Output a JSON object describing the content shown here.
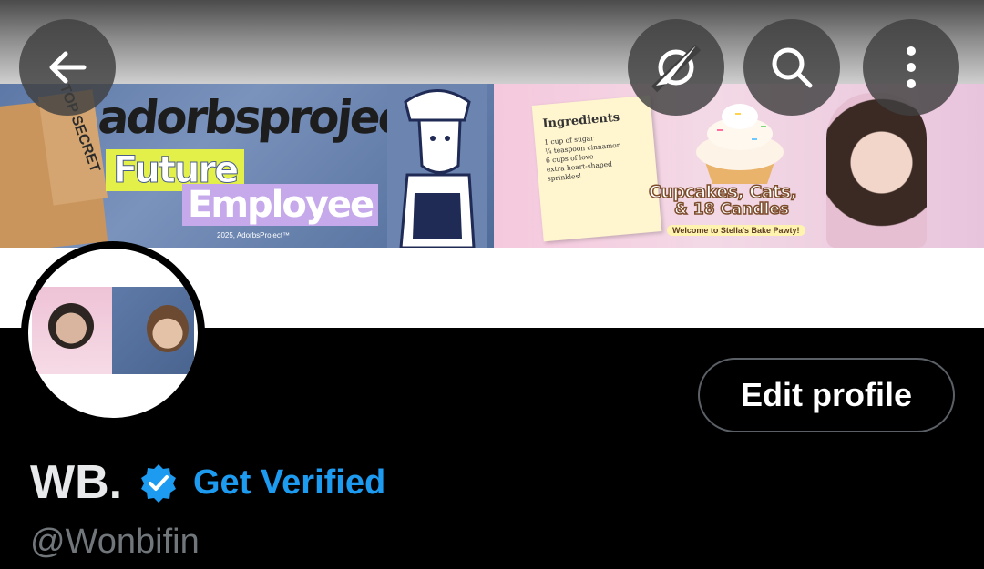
{
  "banner": {
    "left": {
      "box_text": "TOP SECRET",
      "brand": "adorbsproject™",
      "line1": "Future",
      "line2": "Employee",
      "copyright": "2025, AdorbsProject™"
    },
    "right": {
      "ingredients_title": "Ingredients",
      "ingredients_body": "1 cup of sugar\n¼ teaspoon cinnamon\n6 cups of love\nextra heart-shaped sprinkles!",
      "title_line1": "Cupcakes, Cats,",
      "title_line2": "& 18 Candles",
      "welcome": "Welcome to Stella's Bake Pawty!"
    }
  },
  "header_icons": {
    "back": "arrow-left-icon",
    "translate": "translate-icon",
    "search": "search-icon",
    "more": "more-vertical-icon"
  },
  "profile": {
    "name": "WB.",
    "get_verified": "Get Verified",
    "handle": "@Wonbifin",
    "edit_profile": "Edit profile"
  },
  "colors": {
    "accent": "#1d9bf0",
    "background": "#000000",
    "secondary_text": "#71767b"
  }
}
